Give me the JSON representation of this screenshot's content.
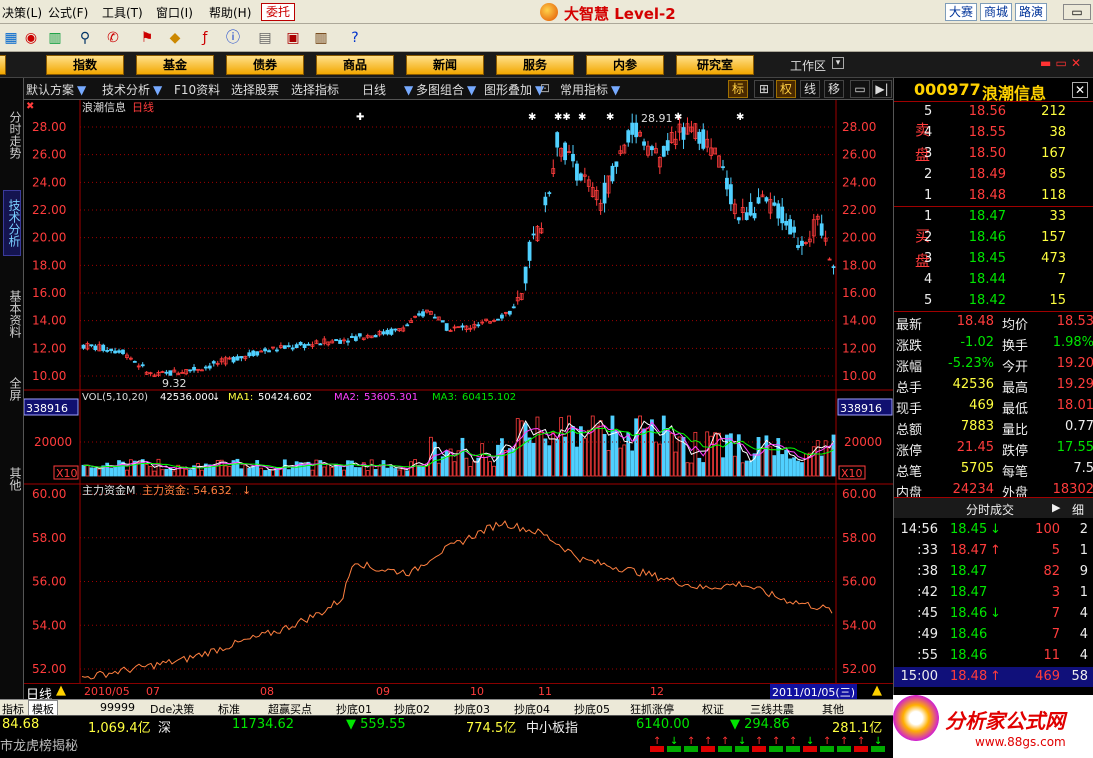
{
  "menu": {
    "items": [
      "决策(L)",
      "公式(F)",
      "工具(T)",
      "窗口(I)",
      "帮助(H)"
    ],
    "entrust": "委托",
    "brand": "大智慧 Level-2",
    "links": [
      "大赛",
      "商城",
      "路演"
    ]
  },
  "nav": {
    "buttons": [
      "股",
      "指数",
      "基金",
      "债券",
      "商品",
      "新闻",
      "服务",
      "内参",
      "研究室"
    ],
    "workarea": "工作区"
  },
  "left_tabs": [
    "分时走势",
    "技术分析",
    "基本资料",
    "全屏",
    "其他"
  ],
  "chartbar": {
    "items": [
      "默认方案",
      "技术分析",
      "F10资料",
      "选择股票",
      "选择指标",
      "日线",
      "多图组合",
      "图形叠加",
      "常用指标"
    ],
    "toggles": [
      "标",
      "⊞",
      "权",
      "线",
      "移",
      "▭",
      "▶|"
    ]
  },
  "chart_data": {
    "type": "candlestick",
    "title": "浪潮信息",
    "period_label": "日线",
    "price_axis": {
      "ticks": [
        "28.00",
        "26.00",
        "24.00",
        "22.00",
        "20.00",
        "18.00",
        "16.00",
        "14.00",
        "12.00",
        "10.00"
      ],
      "range": [
        9.0,
        29.3
      ]
    },
    "high_marker": "28.91",
    "low_marker": "9.32",
    "volume_panel": {
      "label": "VOL(5,10,20)",
      "vol": "42536.000",
      "ma1": "50424.602",
      "ma2": "53605.301",
      "ma3": "60415.102",
      "axis_box": "338916",
      "tick": "20000",
      "scale": "X10"
    },
    "fund_panel": {
      "label": "主力资金M",
      "sublabel": "主力资金: 54.632",
      "ticks": [
        "60.00",
        "58.00",
        "56.00",
        "54.00",
        "52.00"
      ],
      "range": [
        51.2,
        60.2
      ]
    },
    "months": [
      "2010/05",
      "07",
      "08",
      "09",
      "10",
      "11",
      "12"
    ],
    "end_date": "2011/01/05(三)",
    "colors": {
      "up": "#ff3c3c",
      "down": "#50d0ff",
      "ma1": "#ffffff",
      "ma2": "#ff40ff",
      "ma3": "#00ff00",
      "fund": "#ff8040"
    }
  },
  "quote": {
    "code": "000977",
    "name": "浪潮信息",
    "sell_label": "卖盘",
    "buy_label": "买盘",
    "asks": [
      {
        "lvl": "5",
        "price": "18.56",
        "vol": "212"
      },
      {
        "lvl": "4",
        "price": "18.55",
        "vol": "38"
      },
      {
        "lvl": "3",
        "price": "18.50",
        "vol": "167"
      },
      {
        "lvl": "2",
        "price": "18.49",
        "vol": "85"
      },
      {
        "lvl": "1",
        "price": "18.48",
        "vol": "118"
      }
    ],
    "bids": [
      {
        "lvl": "1",
        "price": "18.47",
        "vol": "33"
      },
      {
        "lvl": "2",
        "price": "18.46",
        "vol": "157"
      },
      {
        "lvl": "3",
        "price": "18.45",
        "vol": "473"
      },
      {
        "lvl": "4",
        "price": "18.44",
        "vol": "7"
      },
      {
        "lvl": "5",
        "price": "18.42",
        "vol": "15"
      }
    ],
    "stats": [
      {
        "k1": "最新",
        "v1": "18.48",
        "k2": "均价",
        "v2": "18.53"
      },
      {
        "k1": "涨跌",
        "v1": "-1.02",
        "k2": "换手",
        "v2": "1.98%"
      },
      {
        "k1": "涨幅",
        "v1": "-5.23%",
        "k2": "今开",
        "v2": "19.20"
      },
      {
        "k1": "总手",
        "v1": "42536",
        "k2": "最高",
        "v2": "19.29"
      },
      {
        "k1": "现手",
        "v1": "469",
        "k2": "最低",
        "v2": "18.01"
      },
      {
        "k1": "总额",
        "v1": "7883",
        "k2": "量比",
        "v2": "0.77"
      },
      {
        "k1": "涨停",
        "v1": "21.45",
        "k2": "跌停",
        "v2": "17.55"
      },
      {
        "k1": "总笔",
        "v1": "5705",
        "k2": "每笔",
        "v2": "7.5"
      },
      {
        "k1": "内盘",
        "v1": "24234",
        "k2": "外盘",
        "v2": "18302"
      }
    ],
    "ticks_title": "分时成交",
    "ticks_tab2": "细",
    "ticks": [
      {
        "t": "14:56",
        "p": "18.45",
        "dir": "down",
        "v": "100",
        "n": "2"
      },
      {
        "t": ":33",
        "p": "18.47",
        "dir": "up",
        "v": "5",
        "n": "1"
      },
      {
        "t": ":38",
        "p": "18.47",
        "dir": "",
        "v": "82",
        "n": "9"
      },
      {
        "t": ":42",
        "p": "18.47",
        "dir": "",
        "v": "3",
        "n": "1"
      },
      {
        "t": ":45",
        "p": "18.46",
        "dir": "down",
        "v": "7",
        "n": "4"
      },
      {
        "t": ":49",
        "p": "18.46",
        "dir": "",
        "v": "7",
        "n": "4"
      },
      {
        "t": ":55",
        "p": "18.46",
        "dir": "",
        "v": "11",
        "n": "4"
      },
      {
        "t": "15:00",
        "p": "18.48",
        "dir": "up",
        "v": "469",
        "n": "58"
      }
    ]
  },
  "tabstrip": [
    "指标",
    "模板",
    "99999",
    "Dde决策",
    "标准",
    "超赢买点",
    "抄底01",
    "抄底02",
    "抄底03",
    "抄底04",
    "抄底05",
    "狂抓涨停",
    "权证",
    "三线共震",
    "其他"
  ],
  "indexbar": {
    "a": "84.68",
    "b": "1,069.4亿",
    "c": "深",
    "d": "11734.62",
    "e": "▼ 559.55",
    "f": "774.5亿",
    "g": "中小板指",
    "h": "6140.00",
    "i": "▼ 294.86",
    "j": "281.1亿"
  },
  "news": "市龙虎榜揭秘",
  "banner": {
    "title": "分析家公式网",
    "url": "www.88gs.com"
  }
}
